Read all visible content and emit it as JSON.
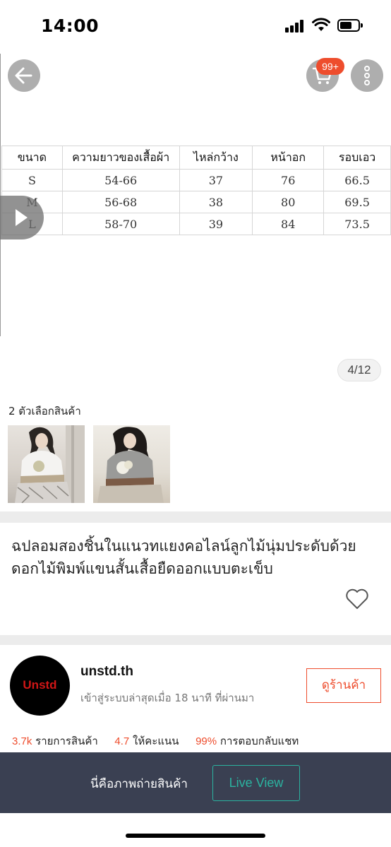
{
  "status_bar": {
    "time": "14:00"
  },
  "gallery": {
    "cart_badge": "99+",
    "page_counter": "4/12",
    "size_table": {
      "headers": [
        "ขนาด",
        "ความยาวของเสื้อผ้า",
        "ไหล่กว้าง",
        "หน้าอก",
        "รอบเอว"
      ],
      "rows": [
        [
          "S",
          "54-66",
          "37",
          "76",
          "66.5"
        ],
        [
          "M",
          "56-68",
          "38",
          "80",
          "69.5"
        ],
        [
          "L",
          "58-70",
          "39",
          "84",
          "73.5"
        ]
      ]
    }
  },
  "variants": {
    "label": "2 ตัวเลือกสินค้า"
  },
  "product": {
    "title": "ฉปลอมสองชิ้นในแนวทแยงคอไลน์ลูกไม้นุ่มประดับด้วยดอกไม้พิมพ์แขนสั้นเสื้อยืดออกแบบตะเข็บ"
  },
  "shop": {
    "logo_text": "Unstd",
    "name": "unstd.th",
    "last_active": "เข้าสู่ระบบล่าสุดเมื่อ 18 นาที ที่ผ่านมา",
    "view_shop_label": "ดูร้านค้า",
    "stats": {
      "products_value": "3.7k",
      "products_label": "รายการสินค้า",
      "rating_value": "4.7",
      "rating_label": "ให้คะแนน",
      "chat_value": "99%",
      "chat_label": "การตอบกลับแชท"
    }
  },
  "bottom_bar": {
    "text": "นี่คือภาพถ่ายสินค้า",
    "live_view_label": "Live View"
  },
  "colors": {
    "accent": "#ee4d2d",
    "live_view": "#2bb3a0",
    "bottom_bar": "#3a4052"
  },
  "icons": [
    "back-arrow-icon",
    "cart-icon",
    "more-icon",
    "play-icon",
    "heart-icon",
    "signal-icon",
    "wifi-icon",
    "battery-icon"
  ]
}
